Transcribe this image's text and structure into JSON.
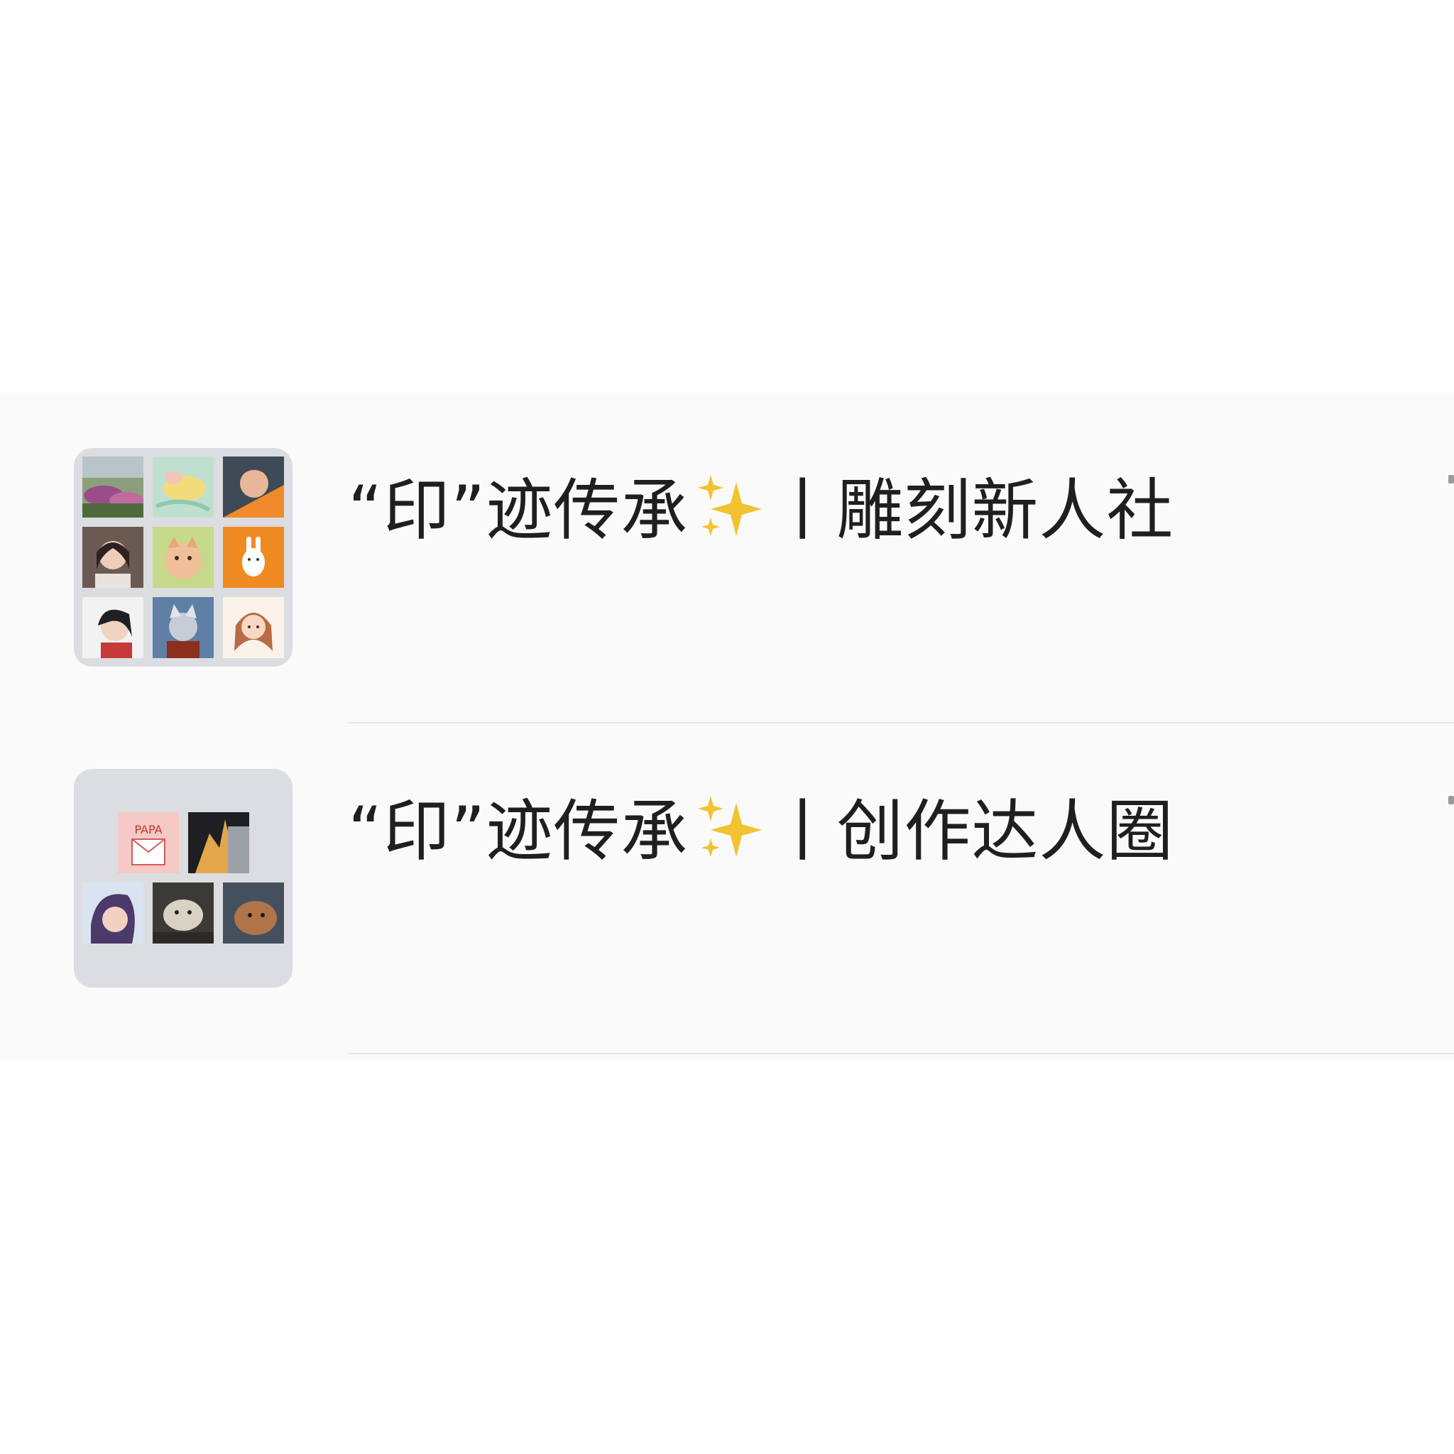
{
  "chats": [
    {
      "title_prefix": "“印”迹传承",
      "sparkle_icon": "sparkles-icon",
      "separator": "丨",
      "title_suffix": "雕刻新人社",
      "preview": ""
    },
    {
      "title_prefix": "“印”迹传承",
      "sparkle_icon": "sparkles-icon",
      "separator": "丨",
      "title_suffix": "创作达人圈",
      "preview": ""
    }
  ],
  "colors": {
    "list_background": "#fafafa",
    "avatar_background": "#dcdde0",
    "title_text": "#1f1f1f",
    "divider": "#e6e6e6",
    "sparkle": "#f2c230"
  }
}
